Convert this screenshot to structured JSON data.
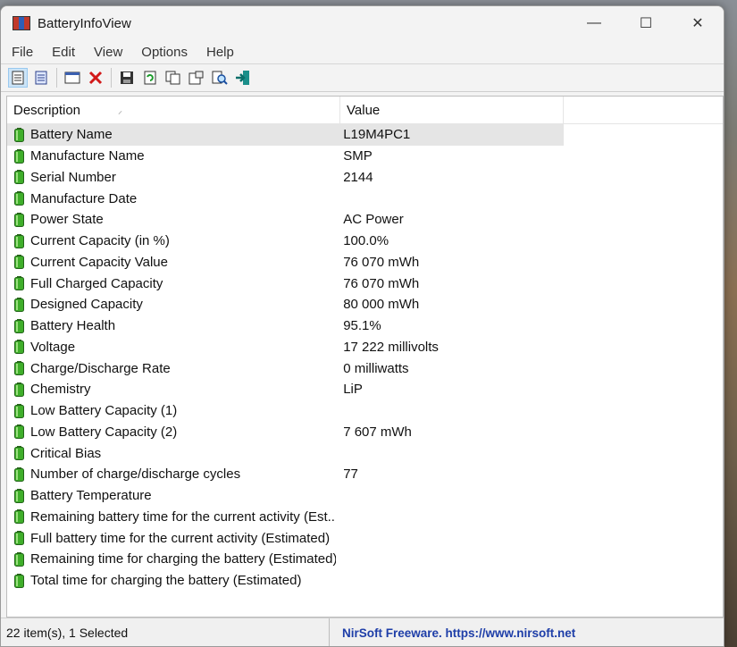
{
  "window": {
    "title": "BatteryInfoView",
    "controls": {
      "minimize": "—",
      "maximize": "☐",
      "close": "✕"
    }
  },
  "menu": [
    "File",
    "Edit",
    "View",
    "Options",
    "Help"
  ],
  "toolbar": {
    "icons": [
      "properties-icon",
      "html-report-icon",
      "window-icon",
      "delete-icon",
      "save-icon",
      "refresh-icon",
      "copy-icon",
      "options-icon",
      "find-icon",
      "exit-icon"
    ]
  },
  "list": {
    "columns": {
      "description": "Description",
      "value": "Value"
    },
    "rows": [
      {
        "description": "Battery Name",
        "value": "L19M4PC1"
      },
      {
        "description": "Manufacture Name",
        "value": "SMP"
      },
      {
        "description": "Serial Number",
        "value": " 2144"
      },
      {
        "description": "Manufacture Date",
        "value": ""
      },
      {
        "description": "Power State",
        "value": "AC Power"
      },
      {
        "description": "Current Capacity (in %)",
        "value": "100.0%"
      },
      {
        "description": "Current Capacity Value",
        "value": "76 070 mWh"
      },
      {
        "description": "Full Charged Capacity",
        "value": "76 070 mWh"
      },
      {
        "description": "Designed Capacity",
        "value": "80 000 mWh"
      },
      {
        "description": "Battery Health",
        "value": "95.1%"
      },
      {
        "description": "Voltage",
        "value": "17 222 millivolts"
      },
      {
        "description": "Charge/Discharge Rate",
        "value": "0 milliwatts"
      },
      {
        "description": "Chemistry",
        "value": "LiP"
      },
      {
        "description": "Low Battery Capacity (1)",
        "value": ""
      },
      {
        "description": "Low Battery Capacity (2)",
        "value": "7 607 mWh"
      },
      {
        "description": "Critical Bias",
        "value": ""
      },
      {
        "description": "Number of charge/discharge cycles",
        "value": "77"
      },
      {
        "description": "Battery Temperature",
        "value": ""
      },
      {
        "description": "Remaining battery time for the current activity (Est...",
        "value": ""
      },
      {
        "description": "Full battery time for the current activity (Estimated)",
        "value": ""
      },
      {
        "description": "Remaining time for charging the battery (Estimated)",
        "value": ""
      },
      {
        "description": "Total  time for charging the battery (Estimated)",
        "value": ""
      }
    ]
  },
  "status": {
    "items": "22 item(s), 1 Selected",
    "credit": "NirSoft Freeware. https://www.nirsoft.net"
  }
}
